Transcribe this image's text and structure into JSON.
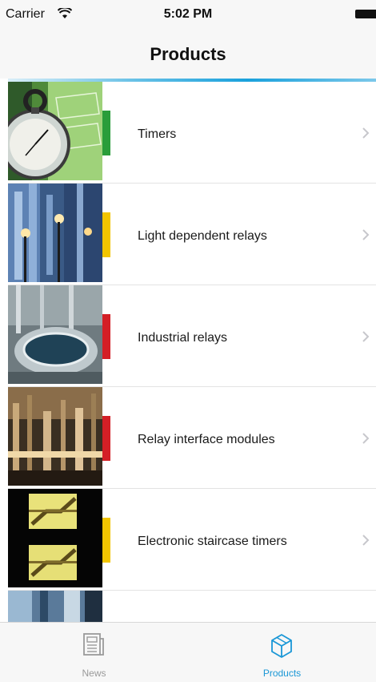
{
  "status_bar": {
    "carrier": "Carrier",
    "time": "5:02 PM"
  },
  "nav": {
    "title": "Products"
  },
  "products": [
    {
      "label": "Timers",
      "accent": "#2a9d3a",
      "thumb": "stopwatch"
    },
    {
      "label": "Light dependent relays",
      "accent": "#f2c500",
      "thumb": "street-lights"
    },
    {
      "label": "Industrial relays",
      "accent": "#d41f26",
      "thumb": "industrial-tank"
    },
    {
      "label": "Relay interface modules",
      "accent": "#d41f26",
      "thumb": "factory"
    },
    {
      "label": "Electronic staircase timers",
      "accent": "#f2c500",
      "thumb": "staircase"
    },
    {
      "label": "",
      "accent": "",
      "thumb": "partial"
    }
  ],
  "tab_bar": {
    "tabs": [
      {
        "label": "News",
        "icon": "newspaper-icon",
        "active": false
      },
      {
        "label": "Products",
        "icon": "box-icon",
        "active": true
      }
    ],
    "active_color": "#1a97d6",
    "inactive_color": "#9a9a9a"
  }
}
